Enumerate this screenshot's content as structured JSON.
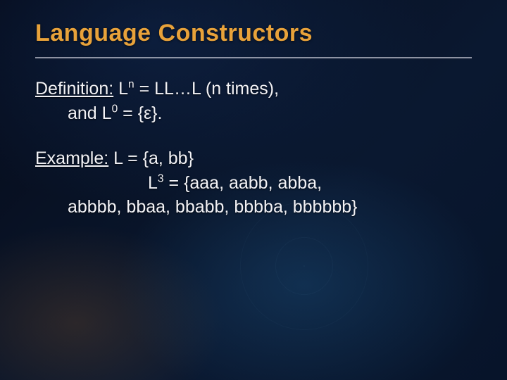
{
  "title": "Language Constructors",
  "definition": {
    "label": "Definition:",
    "line1_a": " L",
    "line1_sup": "n",
    "line1_b": " = LL…L (n times),",
    "line2_a": "and L",
    "line2_sup": "0",
    "line2_b": " = {ε}."
  },
  "example": {
    "label": "Example:",
    "line1": " L = {a, bb}",
    "line2_a": "L",
    "line2_sup": "3",
    "line2_b": " = {aaa, aabb, abba,",
    "line3": "abbbb, bbaa, bbabb, bbbba, bbbbbb}"
  }
}
